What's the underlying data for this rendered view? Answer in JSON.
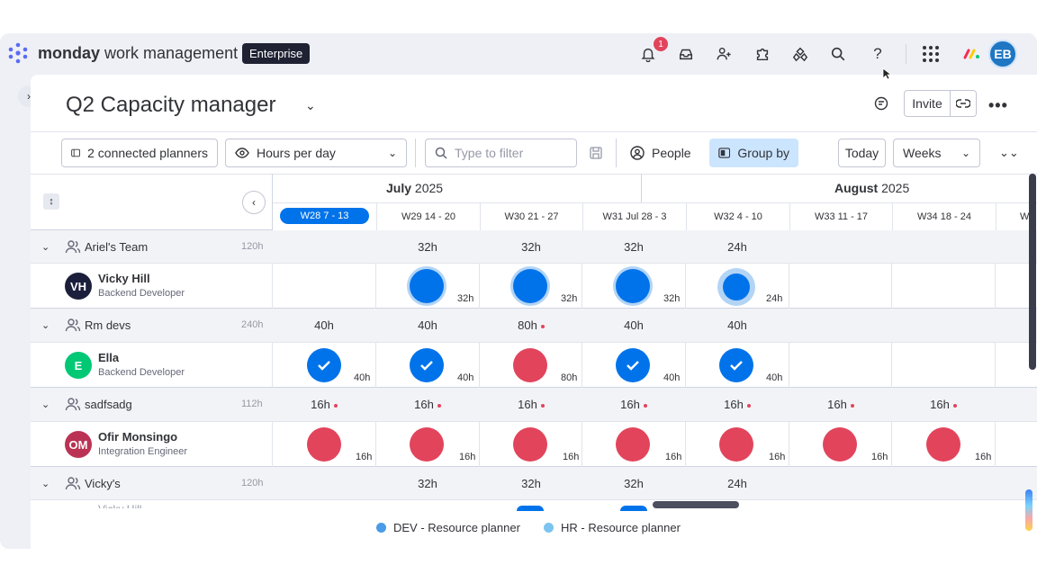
{
  "app": {
    "brand_bold": "monday",
    "brand_rest": "work management",
    "plan_badge": "Enterprise",
    "notifications_count": "1",
    "user_initials": "EB"
  },
  "board": {
    "title": "Q2 Capacity manager",
    "invite_label": "Invite"
  },
  "toolbar": {
    "connected_label": "2 connected planners",
    "view_select": "Hours per day",
    "filter_placeholder": "Type to filter",
    "people_label": "People",
    "group_by_label": "Group by",
    "today_label": "Today",
    "scale_select": "Weeks"
  },
  "timeline": {
    "months": [
      {
        "name": "July",
        "year": "2025"
      },
      {
        "name": "August",
        "year": "2025"
      }
    ],
    "weeks": [
      "W28 7 - 13",
      "W29 14 - 20",
      "W30 21 - 27",
      "W31 Jul 28 - 3",
      "W32 4 - 10",
      "W33 11 - 17",
      "W34 18 - 24",
      "W"
    ]
  },
  "rows": {
    "g1": {
      "name": "Ariel's Team",
      "hours": "120h",
      "cells": [
        "",
        "32h",
        "32h",
        "32h",
        "24h",
        "",
        "",
        ""
      ]
    },
    "p1": {
      "initials": "VH",
      "name": "Vicky Hill",
      "role": "Backend Developer",
      "cells": [
        "",
        "32h",
        "32h",
        "32h",
        "24h",
        "",
        "",
        ""
      ]
    },
    "g2": {
      "name": "Rm devs",
      "hours": "240h",
      "cells": [
        "40h",
        "40h",
        "80h",
        "40h",
        "40h",
        "",
        "",
        ""
      ]
    },
    "p2": {
      "initials": "E",
      "name": "Ella",
      "role": "Backend Developer",
      "cells": [
        "40h",
        "40h",
        "80h",
        "40h",
        "40h",
        "",
        "",
        ""
      ]
    },
    "g3": {
      "name": "sadfsadg",
      "hours": "112h",
      "cells": [
        "16h",
        "16h",
        "16h",
        "16h",
        "16h",
        "16h",
        "16h",
        ""
      ]
    },
    "p3": {
      "initials": "OM",
      "name": "Ofir Monsingo",
      "role": "Integration Engineer",
      "cells": [
        "16h",
        "16h",
        "16h",
        "16h",
        "16h",
        "16h",
        "16h",
        ""
      ]
    },
    "g4": {
      "name": "Vicky's",
      "hours": "120h",
      "cells": [
        "",
        "32h",
        "32h",
        "32h",
        "24h",
        "",
        "",
        ""
      ]
    },
    "p4_partial": {
      "name": "Vicky Hill"
    }
  },
  "legend": [
    {
      "label": "DEV - Resource planner",
      "color": "#4a9be8"
    },
    {
      "label": "HR - Resource planner",
      "color": "#7cc3f0"
    }
  ],
  "colors": {
    "blue": "#0073ea",
    "red": "#e2445c",
    "accent_light": "#cce5ff"
  }
}
